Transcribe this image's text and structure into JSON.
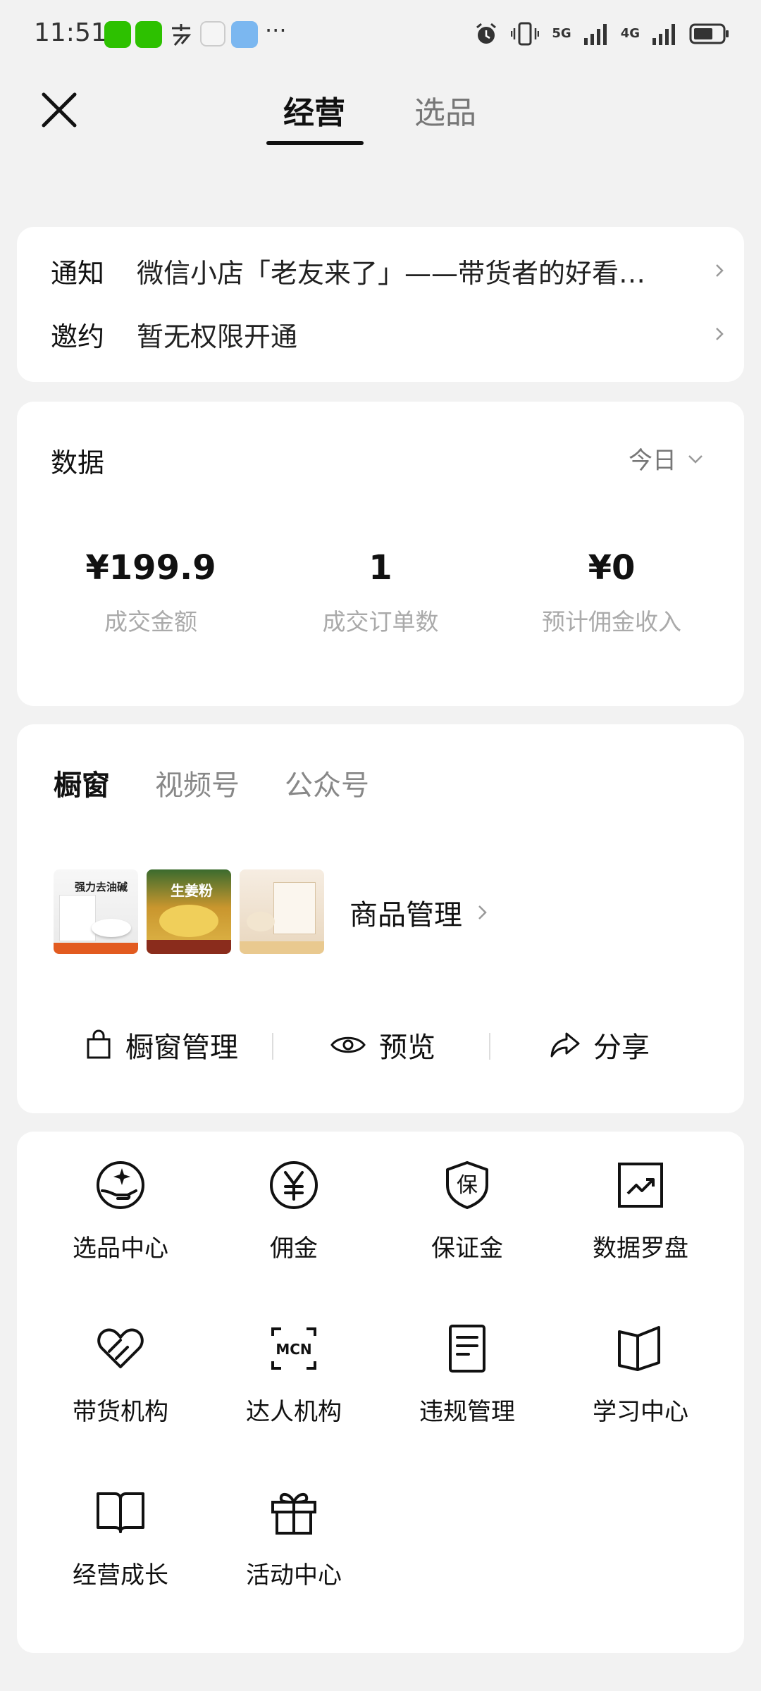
{
  "status_bar": {
    "time": "11:51",
    "signal_5g": "5G",
    "signal_4g": "4G",
    "more": "···"
  },
  "header": {
    "tabs": [
      "经营",
      "选品"
    ],
    "active_tab": "经营"
  },
  "notices": [
    {
      "label": "通知",
      "text": "微信小店「老友来了」——带货者的好看…"
    },
    {
      "label": "邀约",
      "text": "暂无权限开通"
    }
  ],
  "data_section": {
    "title": "数据",
    "filter": "今日",
    "metrics": [
      {
        "value": "¥199.9",
        "label": "成交金额"
      },
      {
        "value": "1",
        "label": "成交订单数"
      },
      {
        "value": "¥0",
        "label": "预计佣金收入"
      }
    ]
  },
  "window_section": {
    "tabs": [
      "橱窗",
      "视频号",
      "公众号"
    ],
    "active_tab": "橱窗",
    "products": [
      {
        "caption": "强力去油碱"
      },
      {
        "caption": "生姜粉"
      },
      {
        "caption": ""
      }
    ],
    "product_manage_label": "商品管理",
    "actions": [
      "橱窗管理",
      "预览",
      "分享"
    ]
  },
  "tools": [
    {
      "icon": "sparkle-hand-icon",
      "label": "选品中心"
    },
    {
      "icon": "yen-circle-icon",
      "label": "佣金"
    },
    {
      "icon": "shield-bao-icon",
      "label": "保证金"
    },
    {
      "icon": "trend-chart-icon",
      "label": "数据罗盘"
    },
    {
      "icon": "handshake-heart-icon",
      "label": "带货机构"
    },
    {
      "icon": "mcn-icon",
      "label": "达人机构"
    },
    {
      "icon": "document-icon",
      "label": "违规管理"
    },
    {
      "icon": "open-book-icon",
      "label": "学习中心"
    },
    {
      "icon": "book-icon",
      "label": "经营成长"
    },
    {
      "icon": "gift-icon",
      "label": "活动中心"
    }
  ],
  "colors": {
    "background": "#f2f2f2",
    "card": "#ffffff",
    "primary_text": "#111111",
    "secondary_text": "#888888"
  }
}
